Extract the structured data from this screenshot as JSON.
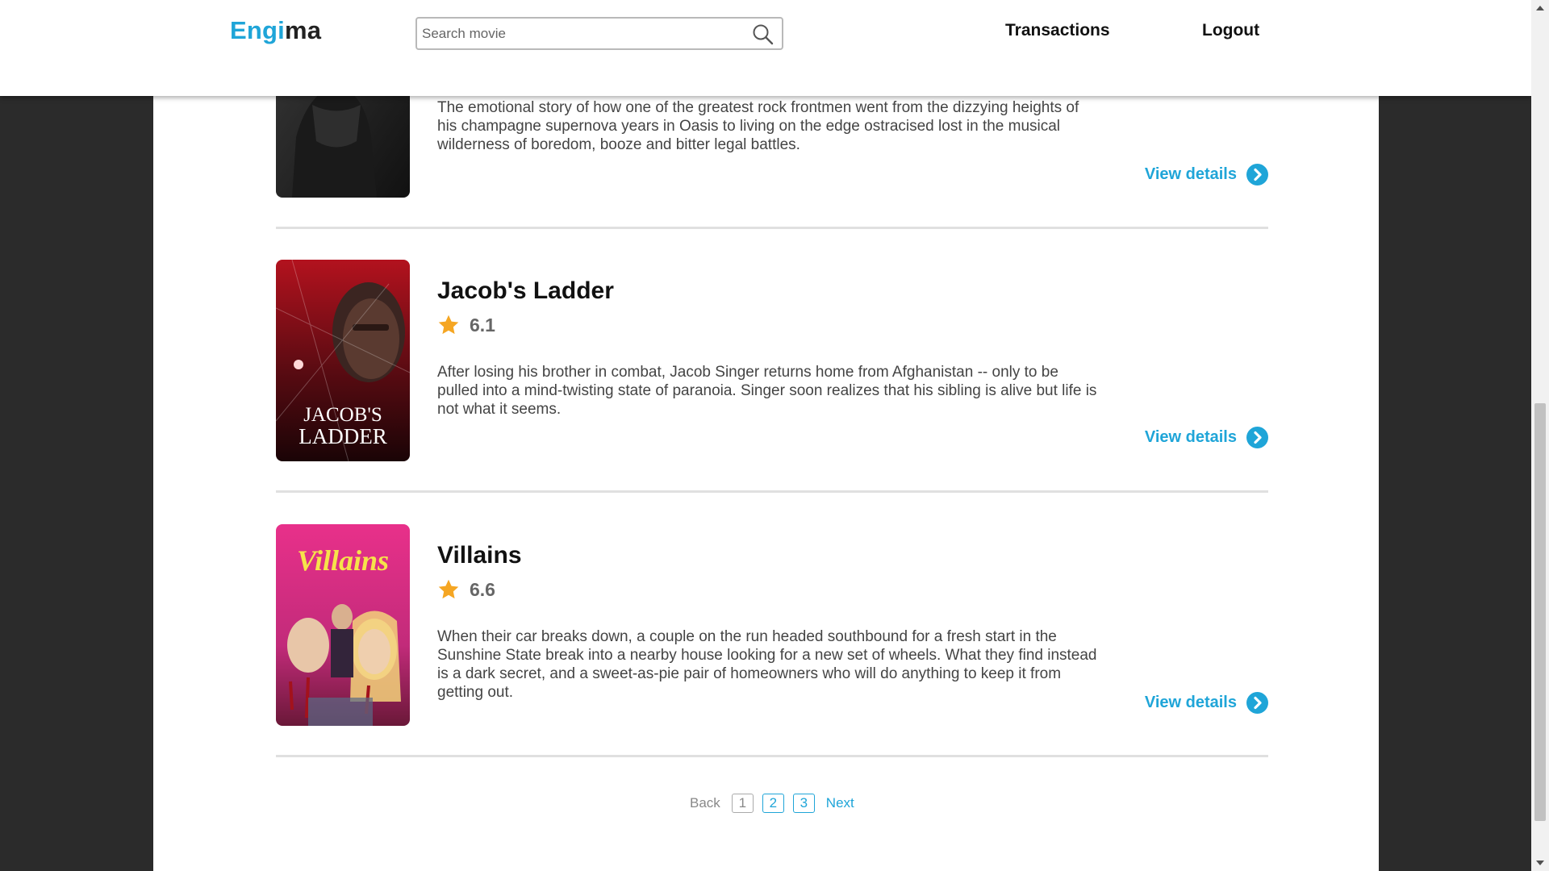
{
  "header": {
    "logo_part1": "Engi",
    "logo_part2": "ma",
    "search_placeholder": "Search movie",
    "nav": {
      "transactions": "Transactions",
      "logout": "Logout"
    }
  },
  "movies": [
    {
      "title": "",
      "synopsis": "The emotional story of how one of the greatest rock frontmen went from the dizzying heights of his champagne supernova years in Oasis to living on the edge ostracised lost in the musical wilderness of boredom, booze and bitter legal battles.",
      "view_details": "View details"
    },
    {
      "title": "Jacob's Ladder",
      "rating": "6.1",
      "synopsis": "After losing his brother in combat, Jacob Singer returns home from Afghanistan -- only to be pulled into a mind-twisting state of paranoia. Singer soon realizes that his sibling is alive but life is not what it seems.",
      "poster_text_line1": "JACOB'S",
      "poster_text_line2": "LADDER",
      "view_details": "View details"
    },
    {
      "title": "Villains",
      "rating": "6.6",
      "synopsis": "When their car breaks down, a couple on the run headed southbound for a fresh start in the Sunshine State break into a nearby house looking for a new set of wheels. What they find instead is a dark secret, and a sweet-as-pie pair of homeowners who will do anything to keep it from getting out.",
      "poster_text": "Villains",
      "view_details": "View details"
    }
  ],
  "pagination": {
    "back": "Back",
    "pages": [
      "1",
      "2",
      "3"
    ],
    "next": "Next"
  },
  "colors": {
    "accent": "#1fa5d8",
    "star": "#f5a623",
    "background": "#2b2b2b",
    "panel": "#ffffff"
  },
  "icons": [
    "search-icon",
    "star-icon",
    "chevron-right-circle-icon"
  ]
}
